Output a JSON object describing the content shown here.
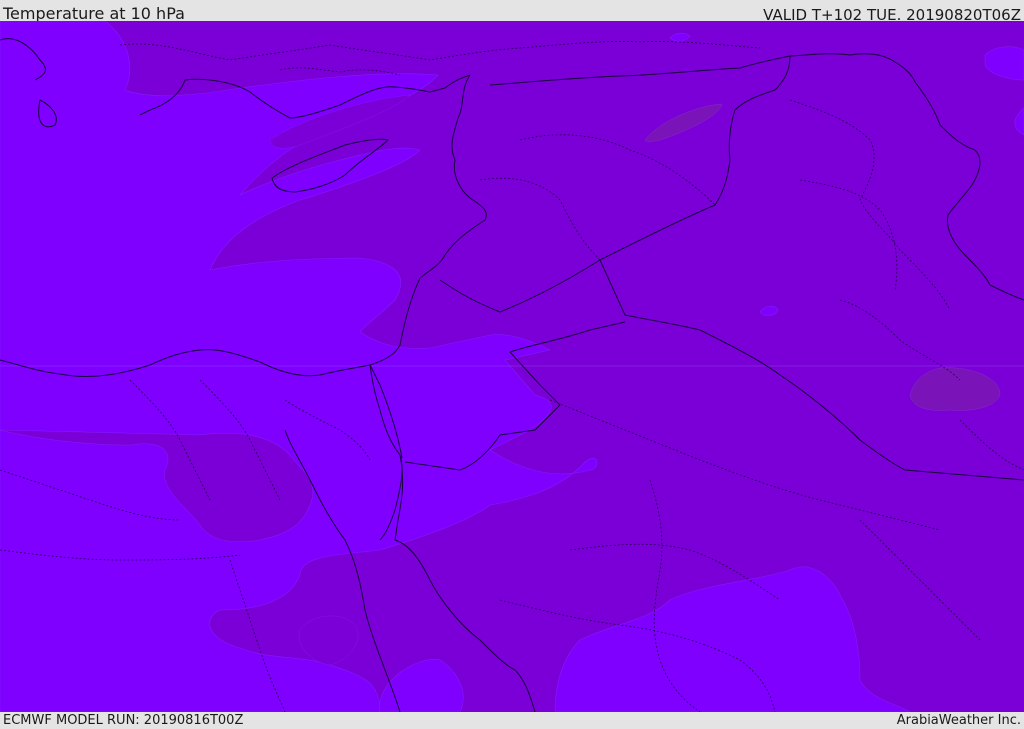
{
  "header": {
    "title": "Temperature at 10 hPa",
    "valid": "VALID T+102 TUE. 20190820T06Z"
  },
  "footer": {
    "model_run": "ECMWF MODEL RUN: 20190816T00Z",
    "credit": "ArabiaWeather Inc."
  },
  "colors": {
    "warm_fill": "#7b00d8",
    "cool_fill": "#7f00ff",
    "warmest_fill": "#7a14b8",
    "coast_line": "#1a0040"
  }
}
